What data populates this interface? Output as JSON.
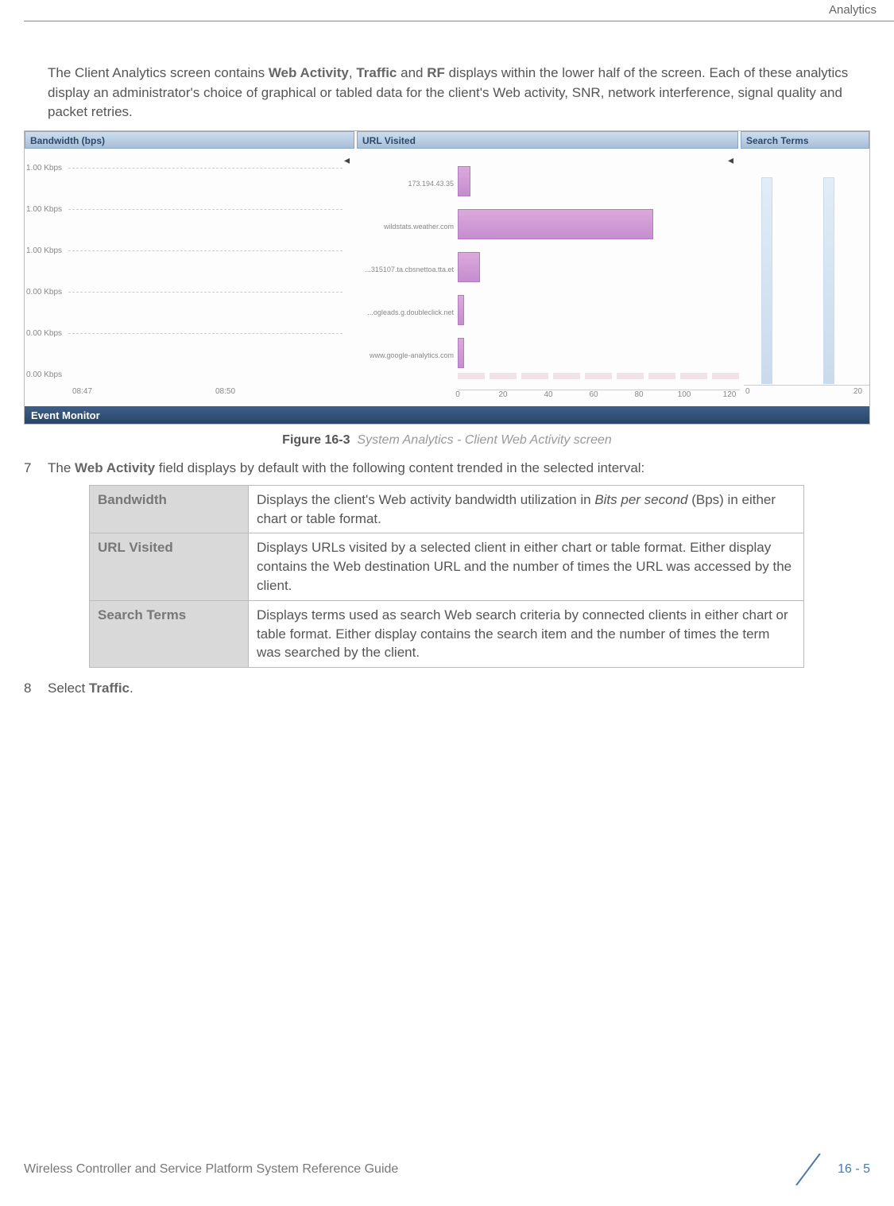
{
  "header": {
    "section": "Analytics"
  },
  "intro": {
    "pre": "The Client Analytics screen contains ",
    "t1": "Web Activity",
    "sep1": ", ",
    "t2": "Traffic",
    "sep2": " and ",
    "t3": "RF",
    "post": " displays within the lower half of the screen. Each of these analytics display an administrator's choice of graphical or tabled data for the client's Web activity, SNR, network interference, signal quality and packet retries."
  },
  "screenshot": {
    "panels": {
      "bandwidth_title": "Bandwidth (bps)",
      "url_title": "URL Visited",
      "search_title": "Search Terms"
    },
    "event_monitor": "Event Monitor"
  },
  "chart_data": [
    {
      "type": "line",
      "title": "Bandwidth (bps)",
      "ylabel": "Kbps",
      "y_ticks": [
        "1.00 Kbps",
        "1.00 Kbps",
        "1.00 Kbps",
        "0.00 Kbps",
        "0.00 Kbps",
        "0.00 Kbps"
      ],
      "x_ticks": [
        "08:47",
        "08:50"
      ],
      "series": []
    },
    {
      "type": "bar",
      "title": "URL Visited",
      "orientation": "horizontal",
      "categories": [
        "173.194.43.35",
        "wildstats.weather.com",
        "...315107.ta.cbsnettoa.tta.et",
        "...ogleads.g.doubleclick.net",
        "www.google-analytics.com"
      ],
      "values": [
        6,
        86,
        10,
        3,
        3
      ],
      "x_ticks": [
        0,
        20,
        40,
        60,
        80,
        100,
        120
      ],
      "xlim": [
        0,
        120
      ]
    },
    {
      "type": "bar",
      "title": "Search Terms",
      "categories": [
        "",
        ""
      ],
      "values": [
        28,
        28
      ],
      "x_ticks": [
        0,
        20
      ],
      "xlim": [
        0,
        20
      ]
    }
  ],
  "figure": {
    "num": "Figure 16-3",
    "desc": "System Analytics - Client Web Activity screen"
  },
  "step7": {
    "num": "7",
    "pre": "The ",
    "term": "Web Activity",
    "post": " field displays by default with the following content trended in the selected interval:"
  },
  "table": {
    "rows": [
      {
        "label": "Bandwidth",
        "desc_pre": "Displays the client's Web activity bandwidth utilization in ",
        "desc_italic": "Bits per second",
        "desc_post": " (Bps) in either chart or table format."
      },
      {
        "label": "URL Visited",
        "desc_pre": "Displays URLs visited by a selected client in either chart or table format. Either display contains the Web destination URL and the number of times the URL was accessed by the client.",
        "desc_italic": "",
        "desc_post": ""
      },
      {
        "label": "Search Terms",
        "desc_pre": "Displays terms used as search Web search criteria by connected clients in either chart or table format. Either display contains the search item and the number of times the term was searched by the client.",
        "desc_italic": "",
        "desc_post": ""
      }
    ]
  },
  "step8": {
    "num": "8",
    "pre": "Select ",
    "term": "Traffic",
    "post": "."
  },
  "footer": {
    "left": "Wireless Controller and Service Platform System Reference Guide",
    "page": "16 - 5"
  }
}
